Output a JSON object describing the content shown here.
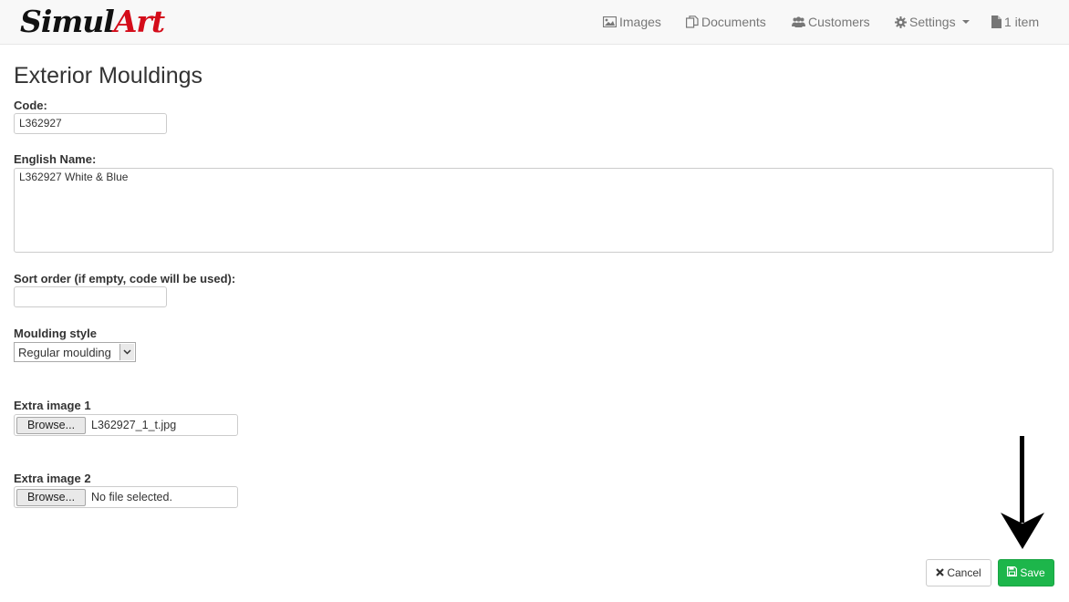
{
  "brand": {
    "part1": "Simul",
    "part2": "Art"
  },
  "nav": {
    "images": "Images",
    "documents": "Documents",
    "customers": "Customers",
    "settings": "Settings",
    "cart": "1 item"
  },
  "page": {
    "title": "Exterior Mouldings"
  },
  "form": {
    "code": {
      "label": "Code:",
      "value": "L362927"
    },
    "english_name": {
      "label": "English Name:",
      "value": "L362927 White & Blue"
    },
    "sort_order": {
      "label": "Sort order (if empty, code will be used):",
      "value": ""
    },
    "moulding_style": {
      "label": "Moulding style",
      "selected": "Regular moulding"
    },
    "extra_image_1": {
      "label": "Extra image 1",
      "browse": "Browse...",
      "file": "L362927_1_t.jpg"
    },
    "extra_image_2": {
      "label": "Extra image 2",
      "browse": "Browse...",
      "file": "No file selected."
    }
  },
  "actions": {
    "cancel": "Cancel",
    "save": "Save"
  },
  "colors": {
    "brand_accent": "#d40c1a",
    "save_button": "#1db64b",
    "annotation_arrow": "#000000"
  },
  "icons": [
    "image-icon",
    "documents-icon",
    "users-icon",
    "gear-icon",
    "file-icon",
    "close-icon",
    "floppy-icon",
    "down-arrow-annotation"
  ]
}
